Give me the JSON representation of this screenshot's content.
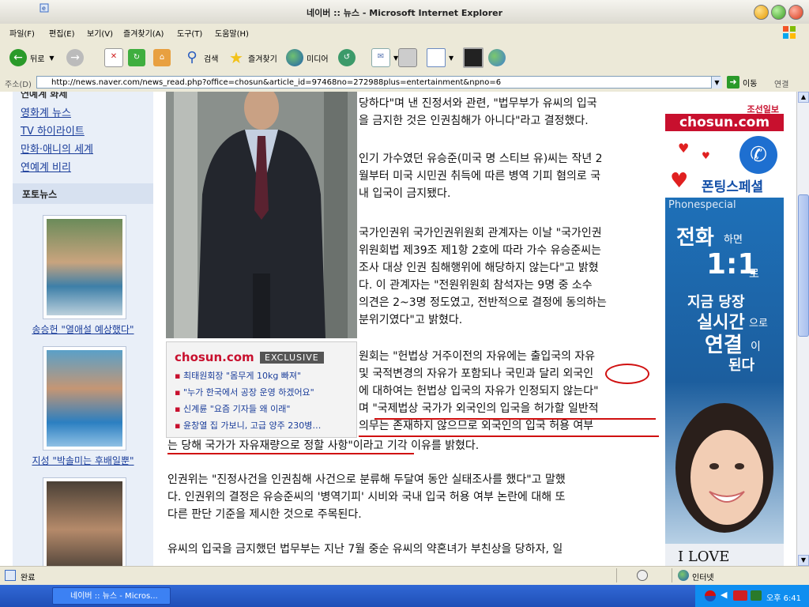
{
  "window": {
    "title": "네이버 :: 뉴스 - Microsoft Internet Explorer"
  },
  "menu": [
    "파일(F)",
    "편집(E)",
    "보기(V)",
    "즐겨찾기(A)",
    "도구(T)",
    "도움말(H)"
  ],
  "toolbar": {
    "back": "뒤로",
    "search": "검색",
    "favorites": "즐겨찾기",
    "media": "미디어"
  },
  "address": {
    "label": "주소(D)",
    "url": "http://news.naver.com/news_read.php?office=chosun&article_id=97468no=272988plus=entertainment&npno=6",
    "go": "이동",
    "links": "연결"
  },
  "sidebar": {
    "cut_heading": "연예계 화제",
    "links": [
      "영화계 뉴스",
      "TV 하이라이트",
      "만화·애니의 세계",
      "연예계 비리"
    ],
    "photo_news_title": "포토뉴스",
    "photos": [
      {
        "caption": "송승헌 \"열애설 예상했다\""
      },
      {
        "caption": "지성 \"박솔미는 후배일뿐\""
      },
      {
        "caption": ""
      }
    ]
  },
  "exclusive": {
    "logo": "chosun.com",
    "tag": "EXCLUSIVE",
    "items": [
      "최태원회장 \"몸무게 10kg 빠져\"",
      "\"누가 한국에서 공장 운영 하겠어요\"",
      "신계륜 \"요즘 기자들 왜 이래\"",
      "윤창열 집 가보니, 고급 양주 230병…"
    ]
  },
  "article": {
    "p1": [
      "당하다\"며 낸 진정서와 관련, \"법무부가 유씨의 입국",
      "을 금지한 것은 인권침해가 아니다\"라고 결정했다."
    ],
    "p2": [
      "인기 가수였던 유승준(미국 명 스티브 유)씨는 작년 2",
      "월부터 미국 시민권 취득에 따른 병역 기피 혐의로 국",
      "내 입국이 금지됐다."
    ],
    "p3": [
      "국가인권위 국가인권위원회 관계자는 이날 \"국가인권",
      "위원회법 제39조 제1항 2호에 따라 가수 유승준씨는",
      "조사 대상 인권 침해행위에 해당하지 않는다\"고 밝혔",
      "다. 이 관계자는 \"전원위원회 참석자는 9명 중 소수",
      "의견은 2~3명 정도였고, 전반적으로 결정에 동의하는",
      "분위기였다\"고 밝혔다."
    ],
    "p4": [
      "원회는 \"헌법상 거주이전의 자유에는 출입국의 자유",
      "및 국적변경의 자유가 포함되나 국민과 달리 외국인",
      "에 대하여는 헌법상 입국의 자유가 인정되지 않는다\"",
      "며 \"국제법상 국가가 외국인의 입국을 허가할 일반적",
      "의무는 존재하지 않으므로 외국인의 입국 허용 여부"
    ],
    "p4_last": "는 당해 국가가 자유재량으로 정할 사항\"이라고 기각 이유를 밝혔다.",
    "p5": [
      "인권위는 \"진정사건을 인권침해 사건으로 분류해 두달여 동안 실태조사를 했다\"고 말했",
      "다. 인권위의 결정은 유승준씨의 '병역기피' 시비와 국내 입국 허용 여부 논란에 대해 또",
      "다른 판단 기준을 제시한 것으로 주목된다."
    ],
    "p6": [
      "유씨의 입국을 금지했던 법무부는 지난 7월 중순 유씨의 약혼녀가 부친상을 당하자, 일"
    ]
  },
  "ad": {
    "paper": "조선일보",
    "site": "chosun.com",
    "promo": "폰팅스페셜",
    "promo_en": "Phonespecial",
    "line1a": "전화",
    "line1b": "하면",
    "line2a": "1:1",
    "line2b": "로",
    "line3": "지금 당장",
    "line4a": "실시간",
    "line4b": "으로",
    "line5a": "연결",
    "line5b": "이",
    "line6": "된다",
    "love": "I LOVE"
  },
  "status": {
    "text": "완료",
    "zone": "인터넷"
  },
  "taskbar": {
    "window": "네이버 :: 뉴스 - Micros...",
    "clock": "오후 6:41"
  }
}
